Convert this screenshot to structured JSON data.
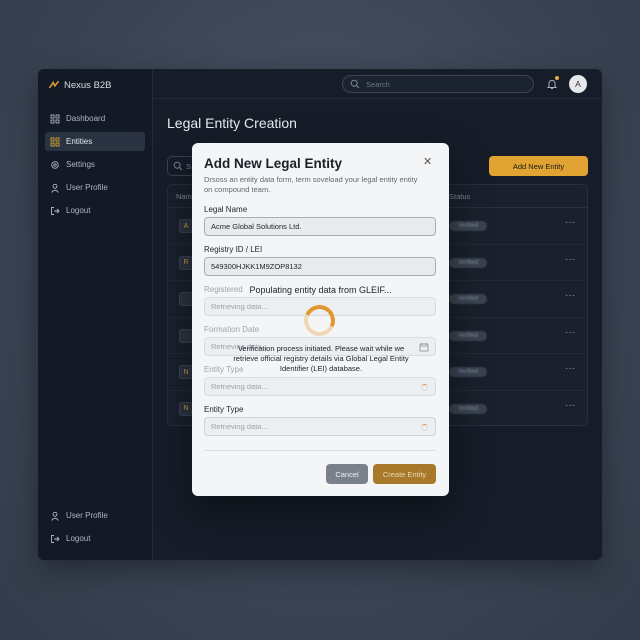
{
  "app": {
    "brand": "Nexus B2B",
    "accent": "#e1a433"
  },
  "sidebar": {
    "items": [
      {
        "label": "Dashboard",
        "icon": "grid-icon"
      },
      {
        "label": "Entities",
        "icon": "entities-icon",
        "active": true
      },
      {
        "label": "Settings",
        "icon": "gear-icon"
      },
      {
        "label": "User Profile",
        "icon": "user-icon"
      },
      {
        "label": "Logout",
        "icon": "logout-icon"
      }
    ],
    "bottom": [
      {
        "label": "User Profile",
        "icon": "user-icon"
      },
      {
        "label": "Logout",
        "icon": "logout-icon"
      }
    ]
  },
  "topbar": {
    "search_placeholder": "Search",
    "avatar_initial": "A"
  },
  "main": {
    "title": "Legal Entity Creation",
    "search_stub": "S",
    "add_button": "Add New Entity",
    "table": {
      "header_name": "Nam",
      "header_status": "Status",
      "rows": [
        {
          "avatar": "A",
          "status": "Verified",
          "actions": "···"
        },
        {
          "avatar": "R",
          "status": "Verified",
          "actions": "···"
        },
        {
          "avatar": "",
          "status": "Verified",
          "actions": "···"
        },
        {
          "avatar": "",
          "status": "Verified",
          "actions": "···"
        },
        {
          "avatar": "N",
          "status": "Verified",
          "actions": "···"
        },
        {
          "avatar": "N",
          "status": "Verified",
          "actions": "···"
        }
      ]
    }
  },
  "modal": {
    "title": "Add New Legal Entity",
    "close": "✕",
    "subtitle": "Drsoss an entity data form, term soveload your legal entity entity on compound team.",
    "fields": {
      "legal_name_label": "Legal Name",
      "legal_name_value": "Acme Global Solutions Ltd.",
      "registry_label": "Registry ID / LEI",
      "registry_value": "549300HJKK1M9ZOP8132",
      "registered_label": "Registered",
      "registered_value": "Retrieving data...",
      "formation_label": "Formation Date",
      "formation_value": "Retrieving data...",
      "entity_type_label_1": "Entity Type",
      "entity_type_value_1": "Retrieving data...",
      "entity_type_label_2": "Entity Type",
      "entity_type_value_2": "Retrieving data..."
    },
    "loader": {
      "title": "Populating entity data from GLEIF...",
      "text": "Verification process initiated. Please wait while we retrieve official registry details via Global Legal Entity Identifier (LEI) database."
    },
    "cancel": "Cancel",
    "create": "Create Entity"
  }
}
